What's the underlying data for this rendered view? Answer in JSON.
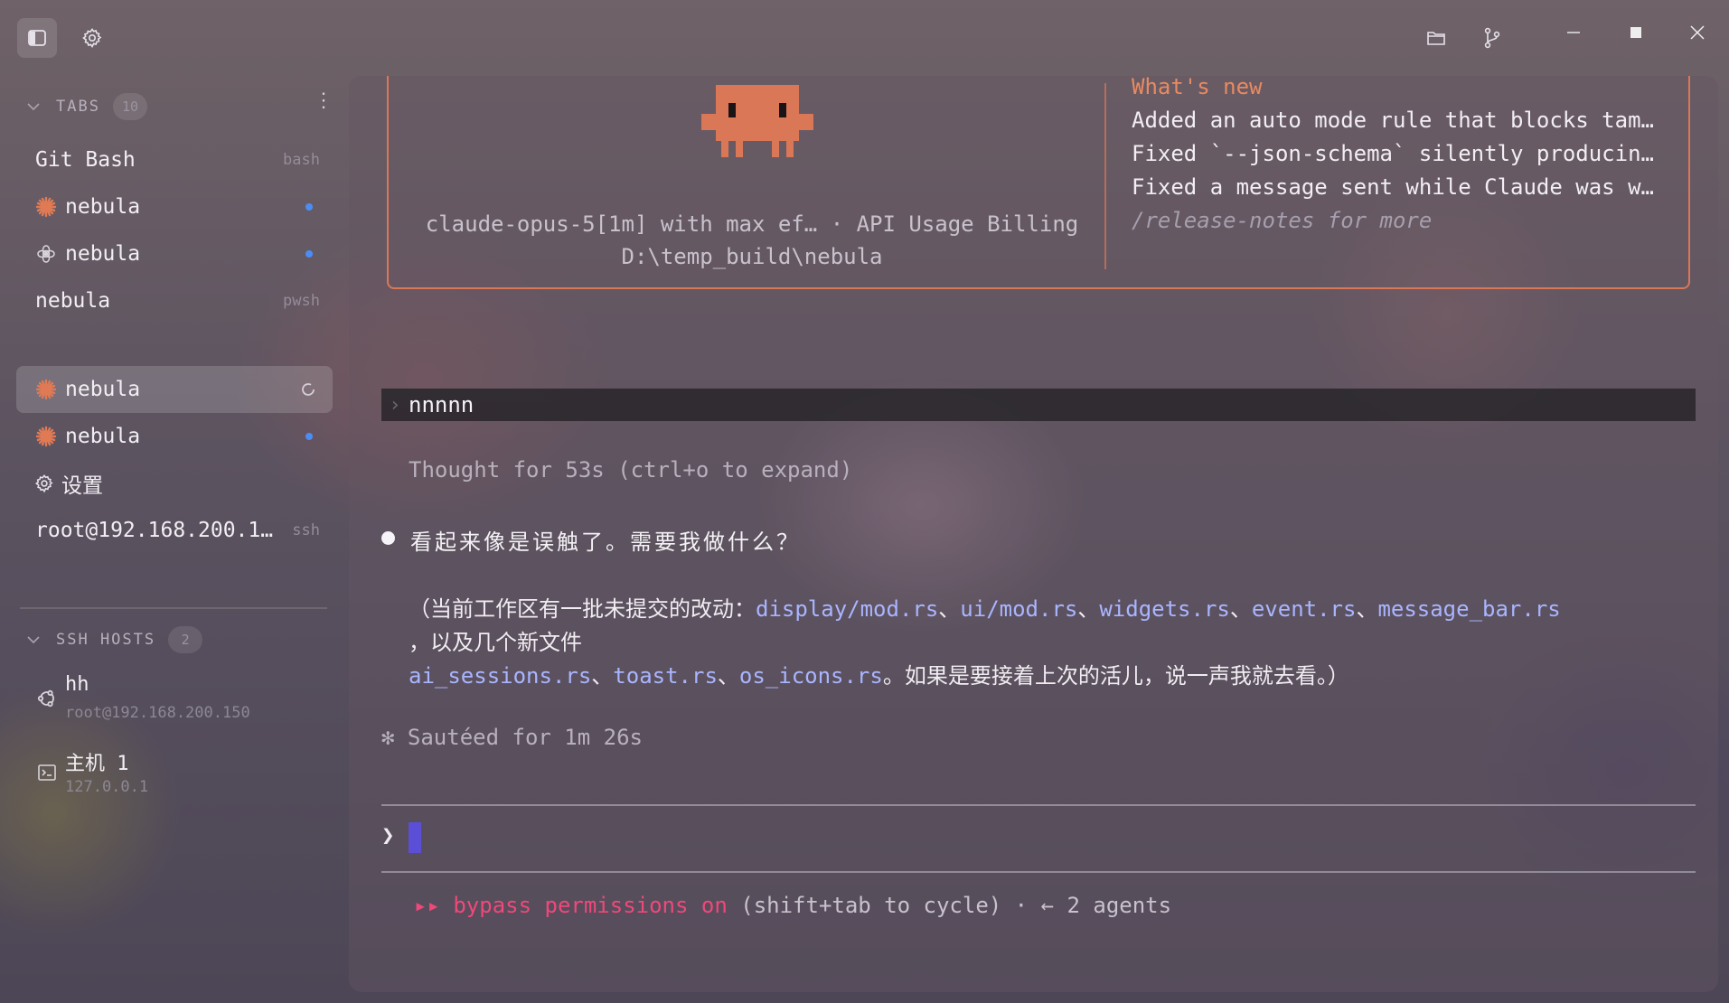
{
  "topbar": {
    "icons": [
      "sidebar-toggle-icon",
      "gear-icon",
      "folder-icon",
      "git-branch-icon"
    ],
    "window_controls": [
      "minimize-icon",
      "maximize-icon",
      "close-icon"
    ]
  },
  "sidebar": {
    "tabs_title": "TABS",
    "tabs_count": "10",
    "tabs": [
      {
        "label": "Git Bash",
        "kind": "bash",
        "icon": null,
        "indicator": null
      },
      {
        "label": "nebula",
        "kind": "",
        "icon": "claude-sparkle-icon",
        "indicator": "dot"
      },
      {
        "label": "nebula",
        "kind": "",
        "icon": "openai-icon",
        "indicator": "dot"
      },
      {
        "label": "nebula",
        "kind": "pwsh",
        "icon": null,
        "indicator": null
      },
      {
        "label": "nebula",
        "kind": "",
        "icon": "claude-sparkle-icon",
        "indicator": "spinner",
        "selected": true
      },
      {
        "label": "nebula",
        "kind": "",
        "icon": "claude-sparkle-icon",
        "indicator": "dot"
      },
      {
        "label": "设置",
        "kind": "",
        "icon": "gear-icon",
        "indicator": null
      },
      {
        "label": "root@192.168.200.1…",
        "kind": "ssh",
        "icon": null,
        "indicator": null
      }
    ],
    "ssh_title": "SSH HOSTS",
    "ssh_count": "2",
    "hosts": [
      {
        "name": "hh",
        "address": "root@192.168.200.150",
        "icon": "ubuntu-icon"
      },
      {
        "name": "主机 1",
        "address": "127.0.0.1",
        "icon": "terminal-icon"
      }
    ]
  },
  "welcome": {
    "model_line": "claude-opus-5[1m] with max ef… · API Usage Billing",
    "path_line": "D:\\temp_build\\nebula",
    "whats_new_title": "What's new",
    "whats_new_lines": [
      "Added an auto mode rule that blocks tam…",
      "Fixed `--json-schema` silently producin…",
      "Fixed a message sent while Claude was w…"
    ],
    "release_notes": "/release-notes for more"
  },
  "conversation": {
    "user_prompt": "nnnnn",
    "thought": "Thought for 53s (ctrl+o to expand)",
    "reply": "看起来像是误触了。需要我做什么？",
    "detail_prefix": "（当前工作区有一批未提交的改动：",
    "changed_files": [
      "display/mod.rs",
      "ui/mod.rs",
      "widgets.rs",
      "event.rs",
      "message_bar.rs"
    ],
    "detail_mid": "，以及几个新文件",
    "new_files": [
      "ai_sessions.rs",
      "toast.rs",
      "os_icons.rs"
    ],
    "detail_suffix": "。如果是要接着上次的活儿，说一声我就去看。）",
    "separator": "、",
    "sauteed": "✻ Sautéed for 1m 26s"
  },
  "input": {
    "prompt_char": "❯"
  },
  "status": {
    "arrows": "▸▸",
    "bypass": "bypass permissions on",
    "rest": " (shift+tab to cycle) · ← 2 agents"
  },
  "colors": {
    "accent_orange": "#d97757",
    "link_blue": "#a9b5ff",
    "status_pink": "#f0487a",
    "indicator_blue": "#4c8df5"
  }
}
